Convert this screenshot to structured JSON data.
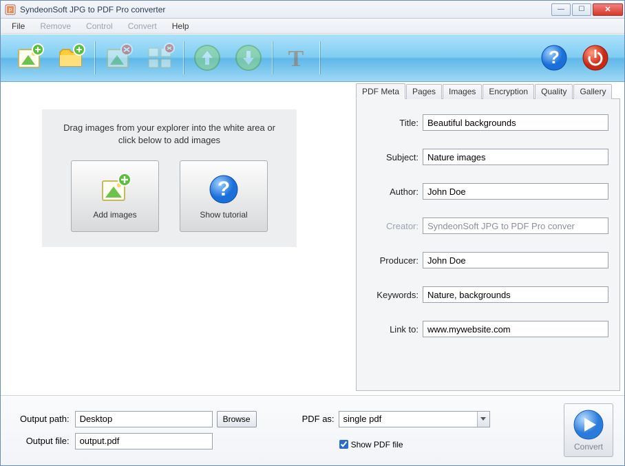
{
  "window": {
    "title": "SyndeonSoft JPG to PDF Pro converter"
  },
  "menu": {
    "file": "File",
    "remove": "Remove",
    "control": "Control",
    "convert": "Convert",
    "help": "Help"
  },
  "toolbar_icons": {
    "add_file": "add-image-icon",
    "add_folder": "add-folder-icon",
    "remove": "remove-image-icon",
    "remove_all": "remove-all-icon",
    "move_up": "arrow-up-icon",
    "move_down": "arrow-down-icon",
    "text": "text-icon",
    "help": "help-icon",
    "power": "power-icon"
  },
  "drop": {
    "hint": "Drag images from your explorer into the white area or click below to add images",
    "add_images": "Add images",
    "show_tutorial": "Show tutorial"
  },
  "tabs": {
    "pdf_meta": "PDF Meta",
    "pages": "Pages",
    "images": "Images",
    "encryption": "Encryption",
    "quality": "Quality",
    "gallery": "Gallery"
  },
  "meta": {
    "labels": {
      "title": "Title:",
      "subject": "Subject:",
      "author": "Author:",
      "creator": "Creator:",
      "producer": "Producer:",
      "keywords": "Keywords:",
      "link_to": "Link to:"
    },
    "values": {
      "title": "Beautiful backgrounds",
      "subject": "Nature images",
      "author": "John Doe",
      "creator": "SyndeonSoft JPG to PDF Pro conver",
      "producer": "John Doe",
      "keywords": "Nature, backgrounds",
      "link_to": "www.mywebsite.com"
    }
  },
  "output": {
    "path_label": "Output path:",
    "path_value": "Desktop",
    "browse": "Browse",
    "file_label": "Output file:",
    "file_value": "output.pdf",
    "pdf_as_label": "PDF as:",
    "pdf_as_value": "single pdf",
    "show_pdf": "Show PDF file",
    "convert": "Convert"
  }
}
